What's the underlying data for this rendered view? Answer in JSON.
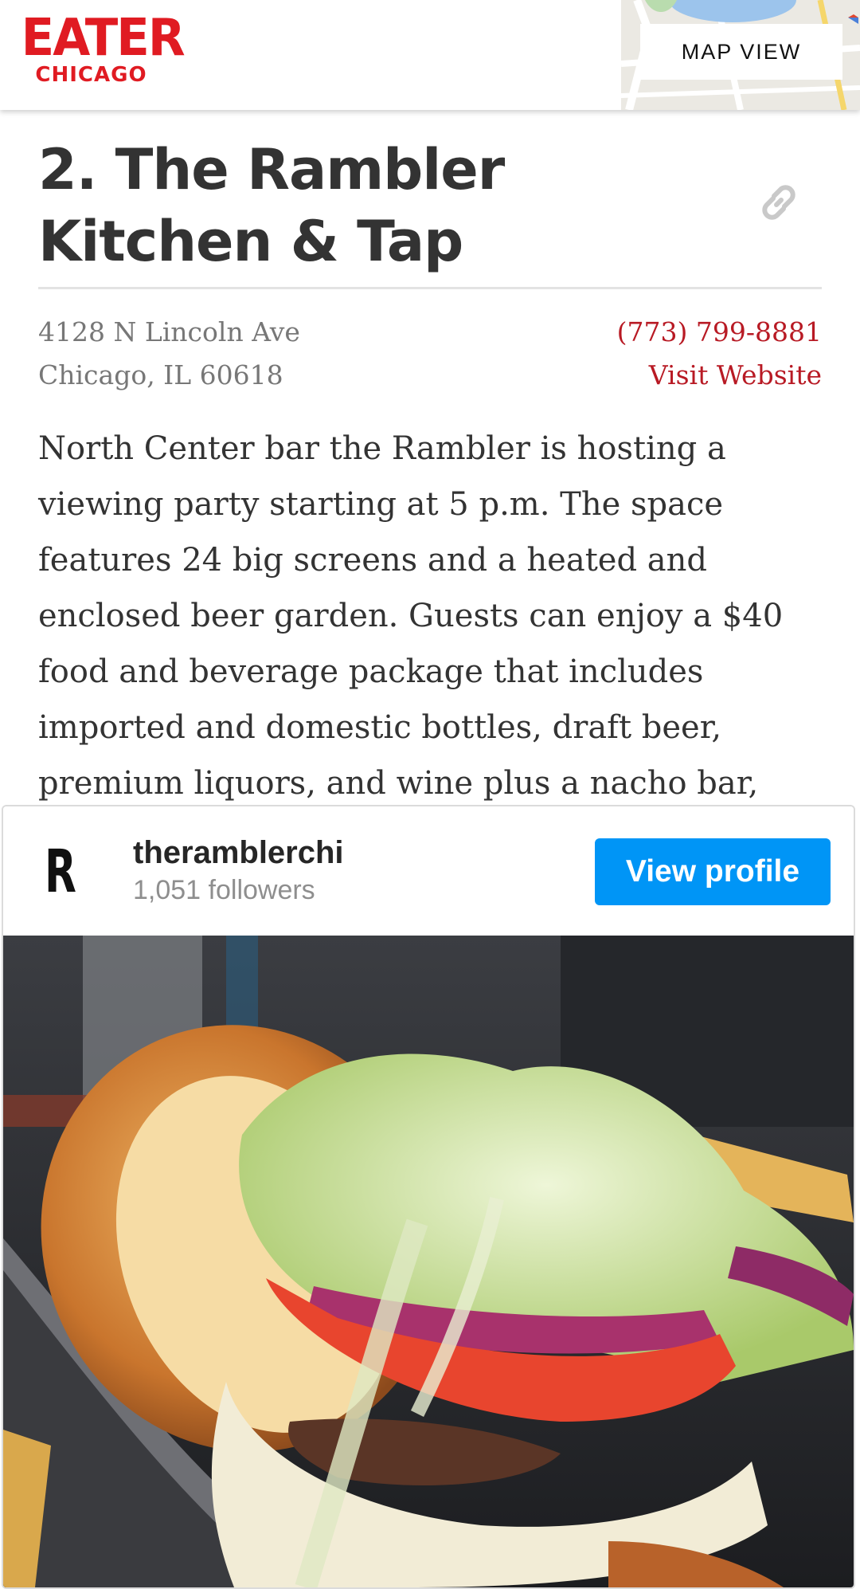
{
  "header": {
    "logo_main": "EATER",
    "logo_sub": "CHICAGO",
    "map_view_label": "MAP VIEW"
  },
  "entry": {
    "title": "2. The Rambler Kitchen & Tap",
    "address_line1": "4128 N Lincoln Ave",
    "address_line2": "Chicago, IL 60618",
    "phone": "(773) 799-8881",
    "website_label": "Visit Website",
    "description": "North Center bar the Rambler is hosting a viewing party starting at 5 p.m. The space features 24 big screens and a heated and enclosed beer garden. Guests can enjoy a $40 food and beverage package that includes imported and domestic bottles, draft beer, premium liquors, and wine plus a nacho bar, taco bar, and more."
  },
  "instagram": {
    "avatar_letter": "R",
    "username": "theramblerchi",
    "followers": "1,051 followers",
    "view_profile_label": "View profile"
  },
  "colors": {
    "brand_red": "#e01b22",
    "link_red": "#b81a24",
    "instagram_blue": "#0095f6"
  },
  "icons": [
    "link-icon"
  ]
}
